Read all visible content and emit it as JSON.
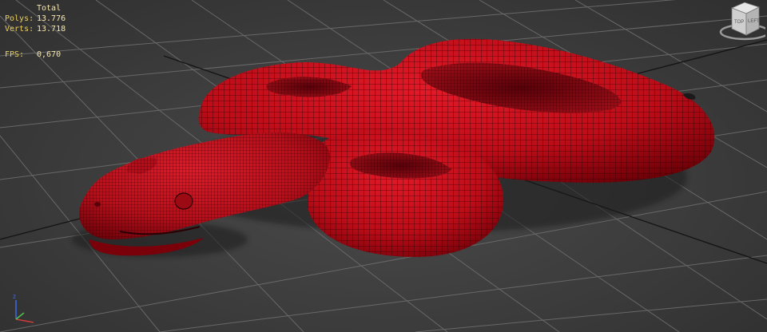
{
  "stats": {
    "header": "Total",
    "polys_label": "Polys:",
    "polys_value": "13.776",
    "verts_label": "Verts:",
    "verts_value": "13.718",
    "fps_label": "FPS:",
    "fps_value": "0,670"
  },
  "viewcube": {
    "icon": "viewcube-icon",
    "front_face_text": "TOP",
    "side_face_text": "LEFT"
  },
  "axis_tripod": {
    "icon": "axis-tripod-icon",
    "z_label": "z",
    "x_color": "#d23a3a",
    "y_color": "#4fc24f",
    "z_color": "#3a6ce0"
  },
  "colors": {
    "viewport_bg": "#3c3c3c",
    "grid_line": "#6a6a6a",
    "grid_axis": "#141414",
    "mesh_red": "#c8101c",
    "wire": "#2a0004",
    "stat_text": "#f0d060"
  }
}
